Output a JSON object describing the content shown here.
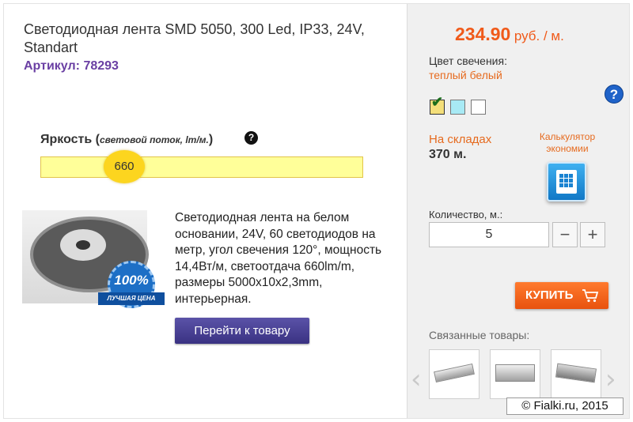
{
  "product": {
    "title": "Светодиодная лента SMD 5050, 300 Led, IP33, 24V, Standart",
    "article_label": "Артикул:",
    "article_value": "78293",
    "description": "Светодиодная лента на белом основании, 24V, 60 светодиодов на метр, угол свечения 120°, мощность 14,4Вт/м, светоотдача 660lm/m, размеры 5000x10x2,3mm, интерьерная.",
    "goto_button": "Перейти к товару",
    "badge_percent": "100%",
    "badge_text": "ЛУЧШАЯ ЦЕНА"
  },
  "brightness": {
    "label": "Яркость",
    "sublabel": "световой поток, lm/м.",
    "value": "660",
    "help_icon": "question-icon"
  },
  "sidebar": {
    "price_value": "234.90",
    "price_unit": "руб. / м.",
    "color_label": "Цвет свечения:",
    "color_value": "теплый белый",
    "help_icon": "question-circle-icon",
    "swatches": [
      {
        "name": "warm-white",
        "color": "#f4df7a",
        "selected": true
      },
      {
        "name": "cyan",
        "color": "#a8eaf5",
        "selected": false
      },
      {
        "name": "white",
        "color": "#ffffff",
        "selected": false
      }
    ],
    "stock_label": "На складах",
    "stock_value": "370 м.",
    "calc_label": "Калькулятор экономии",
    "calc_icon": "calculator-icon",
    "qty_label": "Количество, м.:",
    "qty_value": "5",
    "qty_minus": "−",
    "qty_plus": "+",
    "buy_label": "КУПИТЬ",
    "cart_icon": "cart-icon",
    "related_label": "Связанные товары:",
    "prev_arrow": "‹",
    "next_arrow": "›"
  },
  "footer": {
    "copyright": "© Fialki.ru, 2015"
  },
  "colors": {
    "accent_orange": "#f05a1a",
    "article_purple": "#6a3fa3",
    "button_purple": "#4a4295",
    "buy_orange": "#ff6a1f",
    "brightness_fill": "#ffff99",
    "knob_yellow": "#fcd51f"
  }
}
